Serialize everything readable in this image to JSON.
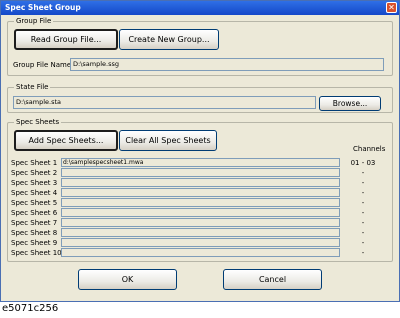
{
  "window": {
    "title": "Spec Sheet Group",
    "close_symbol": "✕"
  },
  "group_file": {
    "legend": "Group File",
    "read_button": "Read Group File...",
    "create_button": "Create New Group...",
    "name_label": "Group File Name",
    "name_value": "D:\\sample.ssg"
  },
  "state_file": {
    "legend": "State File",
    "path_value": "D:\\sample.sta",
    "browse_button": "Browse..."
  },
  "spec_sheets": {
    "legend": "Spec Sheets",
    "add_button": "Add Spec Sheets...",
    "clear_button": "Clear All Spec Sheets",
    "channels_header": "Channels",
    "rows": [
      {
        "label": "Spec Sheet 1",
        "file": "d:\\samplespecsheet1.mwa",
        "channels": "01 - 03"
      },
      {
        "label": "Spec Sheet 2",
        "file": "",
        "channels": "-"
      },
      {
        "label": "Spec Sheet 3",
        "file": "",
        "channels": "-"
      },
      {
        "label": "Spec Sheet 4",
        "file": "",
        "channels": "-"
      },
      {
        "label": "Spec Sheet 5",
        "file": "",
        "channels": "-"
      },
      {
        "label": "Spec Sheet 6",
        "file": "",
        "channels": "-"
      },
      {
        "label": "Spec Sheet 7",
        "file": "",
        "channels": "-"
      },
      {
        "label": "Spec Sheet 8",
        "file": "",
        "channels": "-"
      },
      {
        "label": "Spec Sheet 9",
        "file": "",
        "channels": "-"
      },
      {
        "label": "Spec Sheet 10",
        "file": "",
        "channels": "-"
      }
    ]
  },
  "footer": {
    "ok_button": "OK",
    "cancel_button": "Cancel"
  },
  "caption": "e5071c256"
}
